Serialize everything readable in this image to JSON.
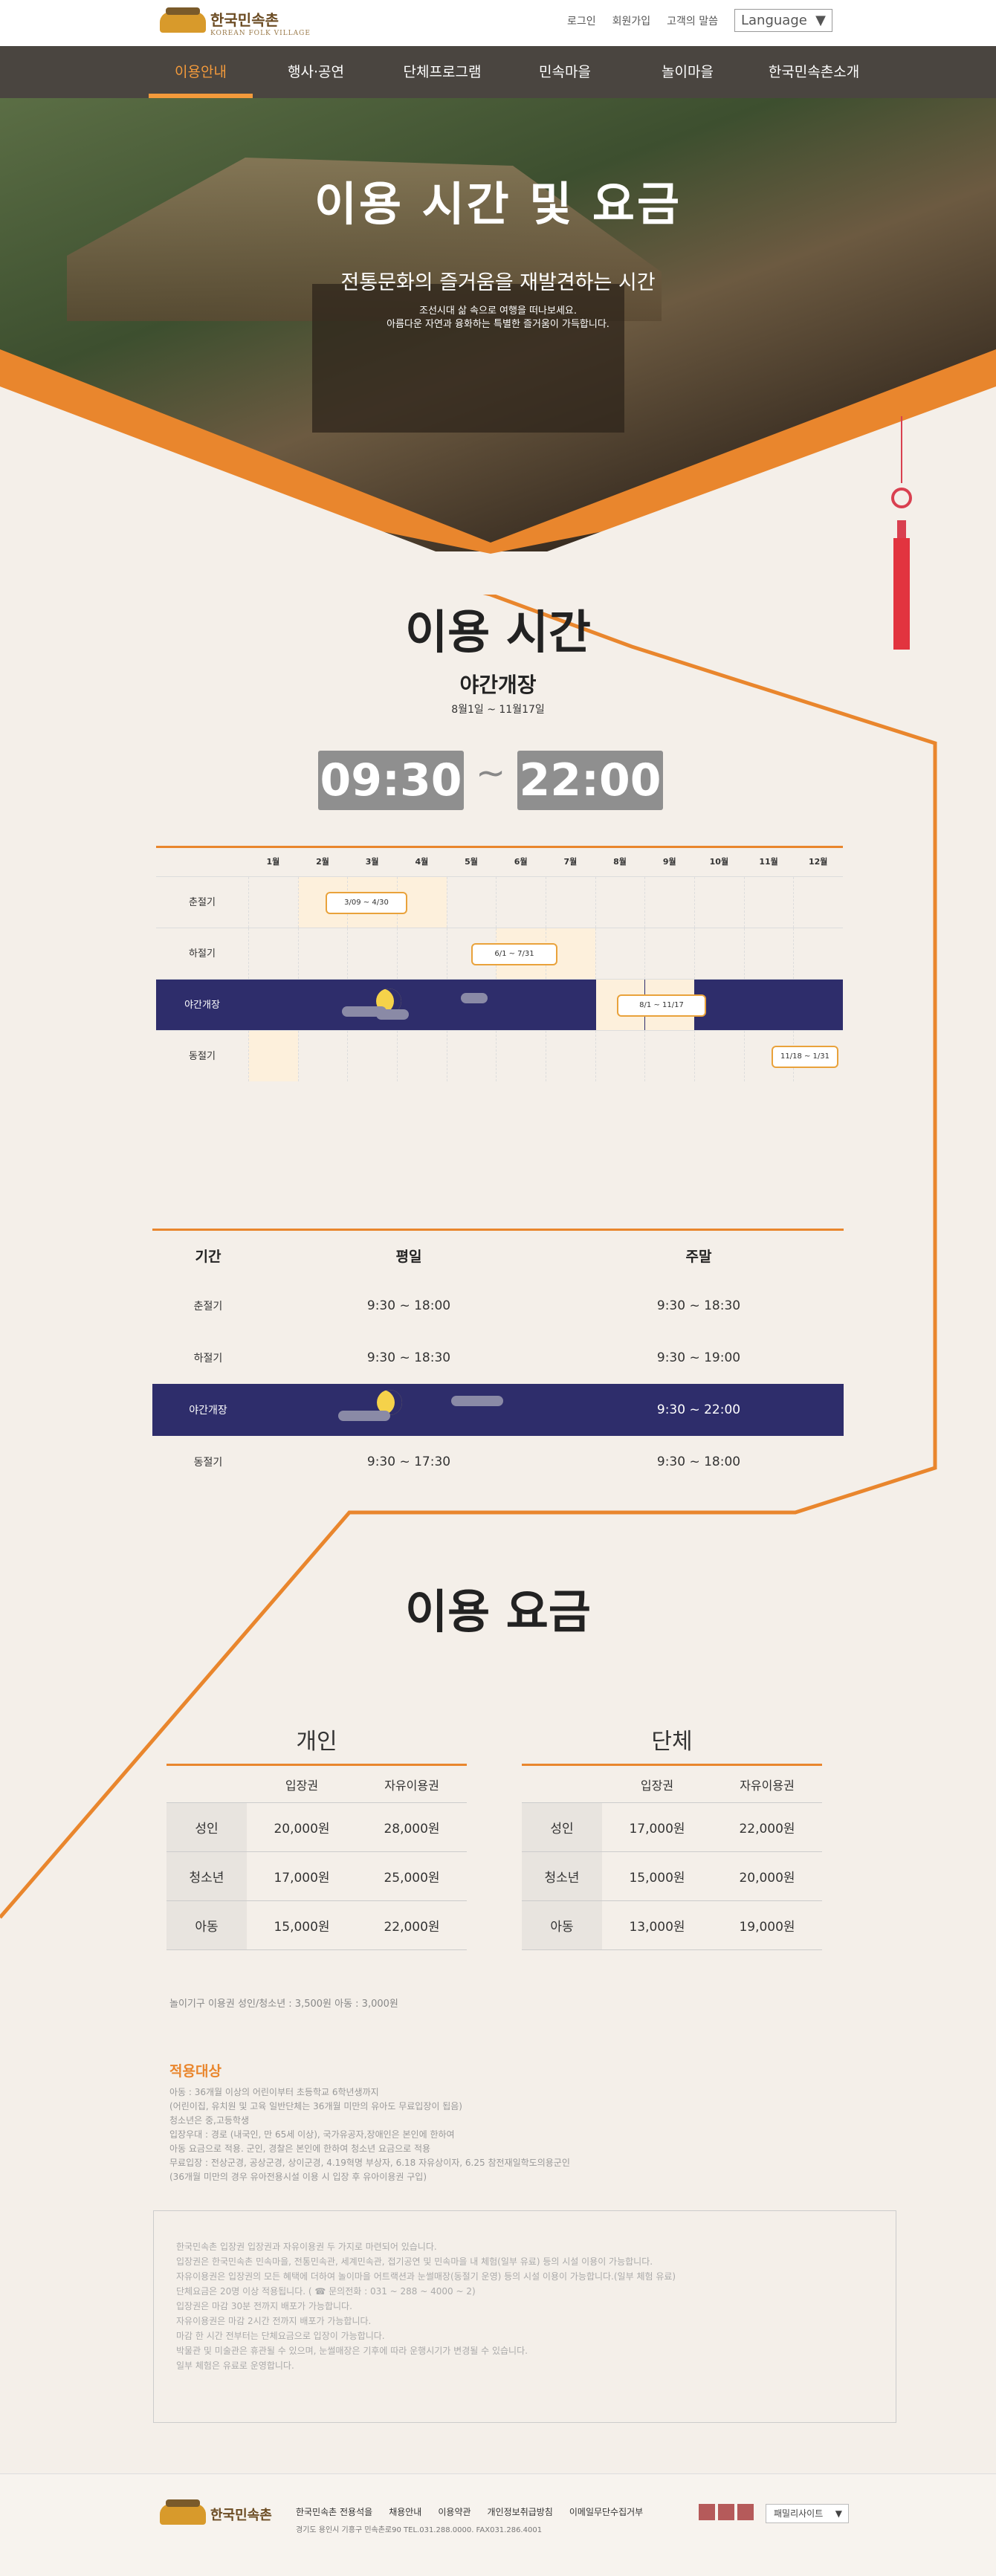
{
  "header": {
    "logo_text": "한국민속촌",
    "logo_sub": "KOREAN FOLK VILLAGE",
    "util_links": [
      "로그인",
      "회원가입",
      "고객의 말씀"
    ],
    "language_label": "Language"
  },
  "gnb": {
    "items": [
      "이용안내",
      "행사·공연",
      "단체프로그램",
      "민속마을",
      "놀이마을",
      "한국민속촌소개"
    ],
    "active_index": 0
  },
  "hero": {
    "title": "이용 시간 및 요금",
    "subtitle": "전통문화의 즐거움을 재발견하는 시간",
    "desc_line1": "조선시대 삶 속으로 여행을 떠나보세요.",
    "desc_line2": "아름다운 자연과 융화하는 특별한 즐거움이 가득합니다."
  },
  "hours_section": {
    "title": "이용 시간",
    "night_title": "야간개장",
    "night_period": "8월1일 ~ 11월17일",
    "open_time": "09:30",
    "tilde": "~",
    "close_time": "22:00"
  },
  "calendar": {
    "months": [
      "1월",
      "2월",
      "3월",
      "4월",
      "5월",
      "6월",
      "7월",
      "8월",
      "9월",
      "10월",
      "11월",
      "12월"
    ],
    "rows": [
      {
        "label": "춘절기",
        "tag": "3/09 ~ 4/30",
        "on_months": [
          2,
          3,
          4
        ]
      },
      {
        "label": "하절기",
        "tag": "6/1 ~ 7/31",
        "on_months": [
          6,
          7
        ]
      },
      {
        "label": "야간개장",
        "tag": "8/1 ~ 11/17",
        "on_months": [
          8,
          9
        ]
      },
      {
        "label": "동절기",
        "tag": "11/18 ~ 1/31",
        "on_months": [
          1
        ]
      }
    ]
  },
  "hours_table": {
    "headers": [
      "기간",
      "평일",
      "주말"
    ],
    "rows": [
      {
        "label": "춘절기",
        "weekday": "9:30 ~ 18:00",
        "weekend": "9:30 ~ 18:30"
      },
      {
        "label": "하절기",
        "weekday": "9:30 ~ 18:30",
        "weekend": "9:30 ~ 19:00"
      },
      {
        "label": "야간개장",
        "weekday": "",
        "weekend": "9:30 ~  22:00"
      },
      {
        "label": "동절기",
        "weekday": "9:30 ~ 17:30",
        "weekend": "9:30 ~ 18:00"
      }
    ]
  },
  "fee_section": {
    "title": "이용 요금",
    "personal_title": "개인",
    "group_title": "단체",
    "col_entry": "입장권",
    "col_free": "자유이용권",
    "personal": [
      {
        "label": "성인",
        "entry": "20,000원",
        "free": "28,000원"
      },
      {
        "label": "청소년",
        "entry": "17,000원",
        "free": "25,000원"
      },
      {
        "label": "아동",
        "entry": "15,000원",
        "free": "22,000원"
      }
    ],
    "group": [
      {
        "label": "성인",
        "entry": "17,000원",
        "free": "22,000원"
      },
      {
        "label": "청소년",
        "entry": "15,000원",
        "free": "20,000원"
      },
      {
        "label": "아동",
        "entry": "13,000원",
        "free": "19,000원"
      }
    ],
    "note": "놀이기구 이용권      성인/청소년 : 3,500원  아동 : 3,000원"
  },
  "target": {
    "title": "적용대상",
    "lines": [
      "아동 : 36개월 이상의 어린이부터 초등학교 6학년생까지",
      "(어린이집, 유치원 및 고육 일반단체는 36개월 미만의 유아도 무료입장이 됩음)",
      "청소년은 중,고등학생",
      "입장우대 : 경로 (내국인, 만 65세 이상), 국가유공자,장애인은 본인에 한하여",
      "아동 요금으로 적용. 군인, 경찰은 본인에 한하여 청소년 요금으로 적용",
      "무료입장 : 전상군경, 공상군경, 상이군경, 4.19혁명 부상자, 6.18 자유상이자, 6.25 참전재일학도의용군인",
      "(36개월 미만의 경우 유아전용시설 이용 시 입장 후 유아이용권 구입)"
    ]
  },
  "notice": {
    "lines": [
      "한국민속촌 입장권 입장권과 자유이용권 두 가지로 마련되어 있습니다.",
      "입장권은 한국민속촌 민속마을, 전통민속관, 세계민속관, 접기공연 및 민속마을 내 체험(일부 유료) 등의 시설 이용이 가능합니다.",
      "자유이용권은 입장권의 모든 혜택에 더하여 놀이마을 어트랙션과 눈썰매장(동절기 운영) 등의 시설 이용이 가능합니다.(일부 체험 유료)",
      "단체요금은 20명 이상 적용됩니다. ( ☎ 문의전화 : 031 ~ 288 ~ 4000 ~ 2)",
      "입장권은 마감 30분 전까지 배포가 가능합니다.",
      "자유이용권은 마감 2시간 전까지 배포가 가능합니다.",
      "마감 한 시간 전부터는 단체요금으로 입장이 가능합니다.",
      "박물관 및 미술관은 휴관될 수 있으며, 눈썰매장은 기후에 따라 운행시기가 변경될 수 있습니다.",
      "일부 체험은 유료로 운영합니다."
    ]
  },
  "footer": {
    "links": [
      "한국민속촌 전용석을",
      "채용안내",
      "이용약관",
      "개인정보취급방침",
      "이메일무단수집거부"
    ],
    "address": "경기도 용인시 기흥구 민속촌로90 TEL.031.288.0000. FAX031.286.4001",
    "family_site": "패밀리사이트"
  },
  "colors": {
    "accent": "#e9862d",
    "gnb_bg": "#4a4540",
    "night_bg": "#2e2d6b",
    "time_box": "#8f8f8f"
  }
}
